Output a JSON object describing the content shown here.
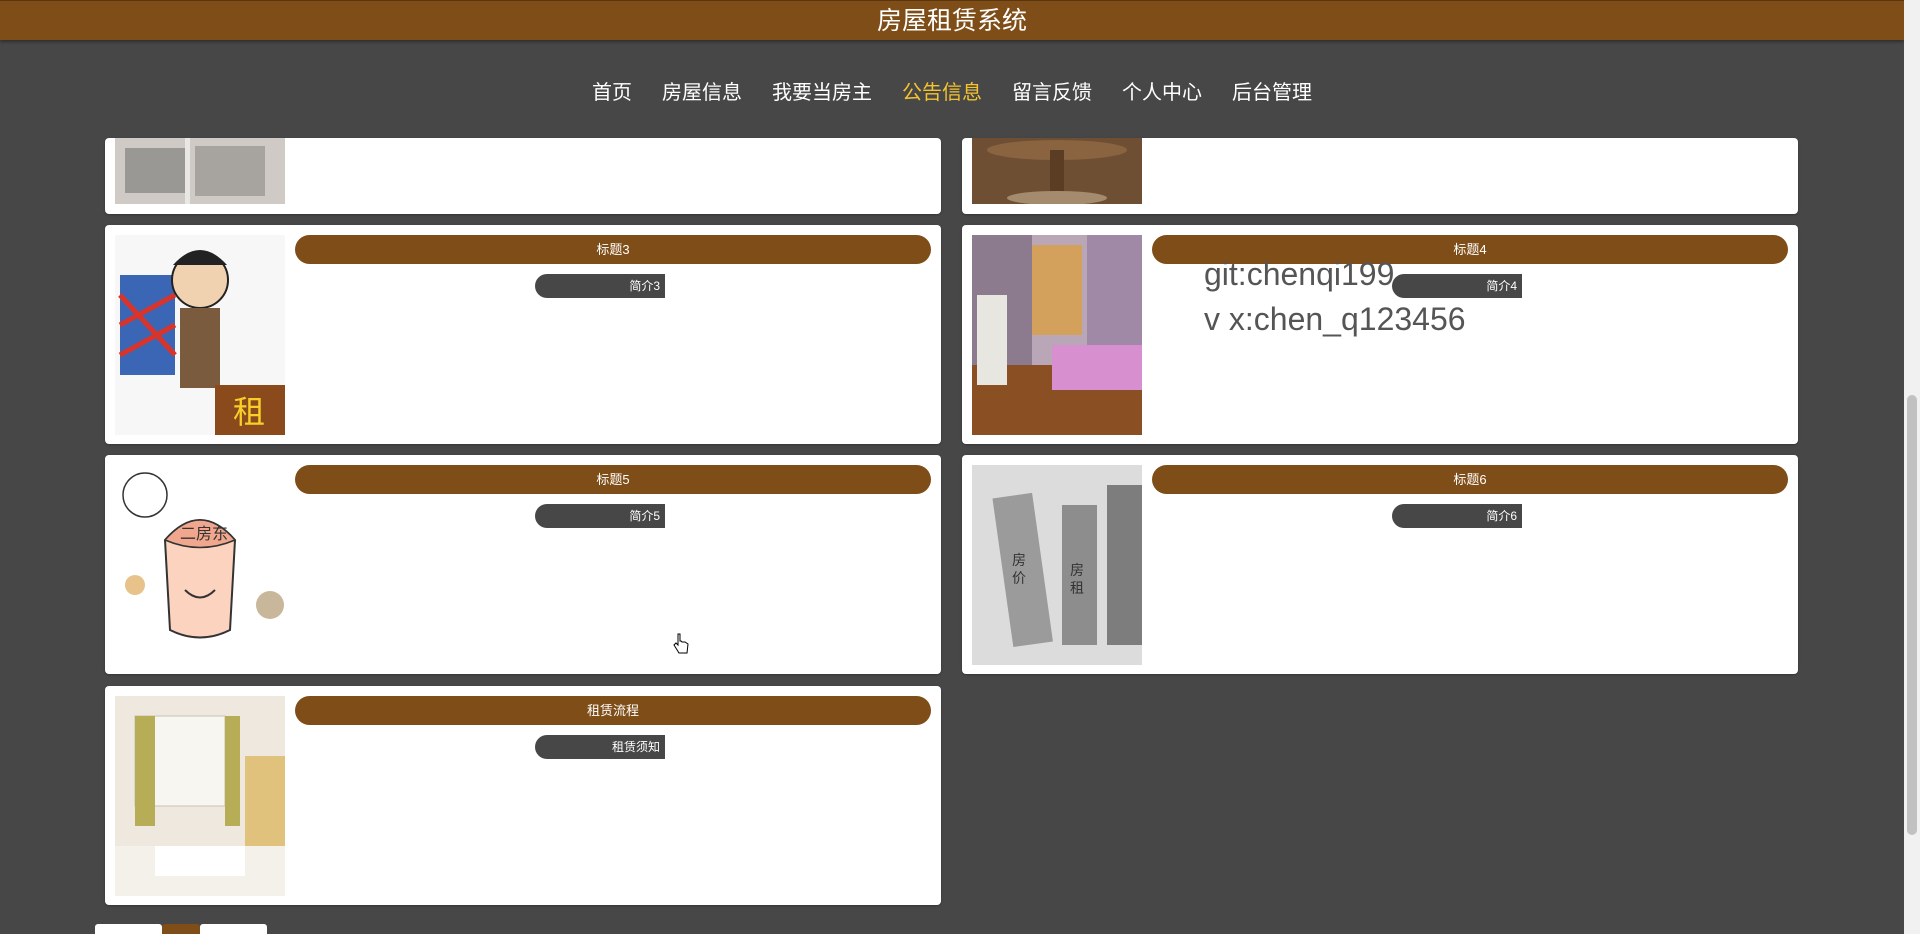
{
  "header": {
    "title": "房屋租赁系统"
  },
  "nav": {
    "items": [
      {
        "label": "首页"
      },
      {
        "label": "房屋信息"
      },
      {
        "label": "我要当房主"
      },
      {
        "label": "公告信息",
        "active": true
      },
      {
        "label": "留言反馈"
      },
      {
        "label": "个人中心"
      },
      {
        "label": "后台管理"
      }
    ]
  },
  "cards": [
    {
      "title": "标题3",
      "intro": "简介3",
      "image": "cartoon-tenant-with-rent-sign"
    },
    {
      "title": "标题4",
      "intro": "简介4",
      "image": "bedroom-photo"
    },
    {
      "title": "标题5",
      "intro": "简介5",
      "image": "cartoon-sublandlord-character"
    },
    {
      "title": "标题6",
      "intro": "简介6",
      "image": "cartoon-rising-rent-buildings"
    },
    {
      "title": "租赁流程",
      "intro": "租赁须知",
      "image": "bright-room-photo"
    }
  ],
  "watermark": {
    "line1": "git:chenqi199",
    "line2": "v x:chen_q123456"
  },
  "colors": {
    "brand": "#7f4d17",
    "background": "#474747",
    "active_nav": "#f5c330"
  }
}
